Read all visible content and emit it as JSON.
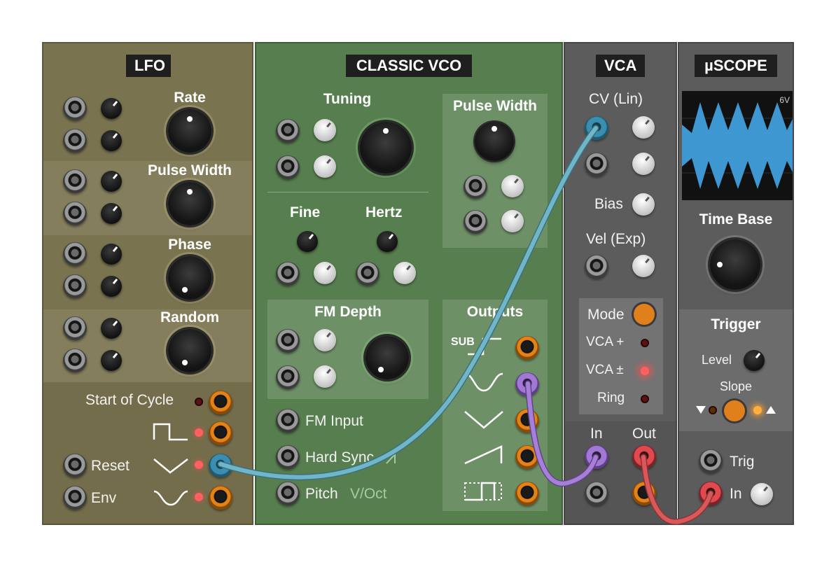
{
  "lfo": {
    "title": "LFO",
    "rate_label": "Rate",
    "pulse_width_label": "Pulse Width",
    "phase_label": "Phase",
    "random_label": "Random",
    "start_of_cycle_label": "Start of Cycle",
    "reset_label": "Reset",
    "env_label": "Env"
  },
  "vco": {
    "title": "CLASSIC VCO",
    "tuning_label": "Tuning",
    "pulse_width_label": "Pulse Width",
    "fine_label": "Fine",
    "hertz_label": "Hertz",
    "fm_depth_label": "FM Depth",
    "outputs_label": "Outputs",
    "sub_label": "SUB",
    "fm_input_label": "FM Input",
    "hard_sync_label": "Hard Sync",
    "pitch_label": "Pitch",
    "voct_label": "V/Oct"
  },
  "vca": {
    "title": "VCA",
    "cv_lin_label": "CV (Lin)",
    "bias_label": "Bias",
    "vel_exp_label": "Vel (Exp)",
    "mode_label": "Mode",
    "vca_plus_label": "VCA +",
    "vca_pm_label": "VCA ±",
    "ring_label": "Ring",
    "in_label": "In",
    "out_label": "Out"
  },
  "scope": {
    "title": "µSCOPE",
    "scale_label": "6V",
    "time_base_label": "Time Base",
    "trigger_label": "Trigger",
    "level_label": "Level",
    "slope_label": "Slope",
    "trig_label": "Trig",
    "in_label": "In"
  },
  "colors": {
    "lfo_panel": "#7a7350",
    "vco_panel": "#577e4e",
    "vca_panel": "#5c5c5c",
    "scope_panel": "#5c5c5c",
    "cable_blue": "#6fb6c9",
    "cable_purple": "#a77fd8",
    "cable_red": "#d9595b",
    "scope_trace": "#3f97d1"
  }
}
